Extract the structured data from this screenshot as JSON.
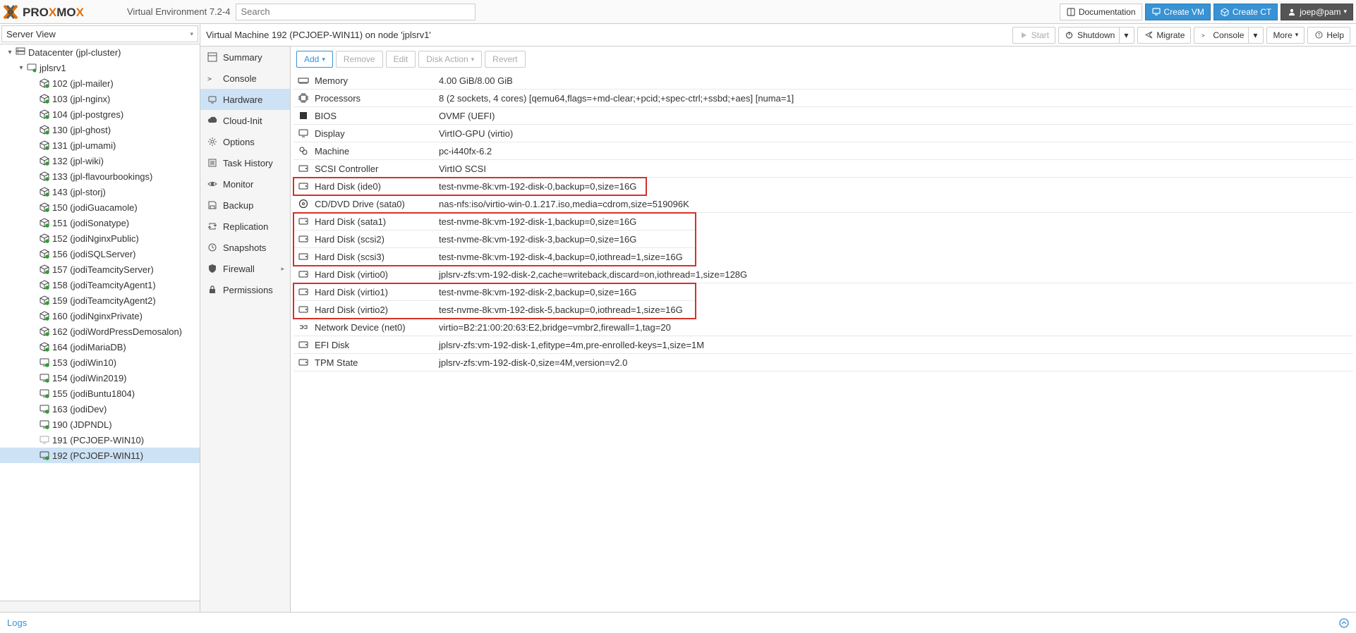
{
  "header": {
    "ve_label": "Virtual Environment 7.2-4",
    "search_placeholder": "Search",
    "documentation": "Documentation",
    "create_vm": "Create VM",
    "create_ct": "Create CT",
    "user": "joep@pam"
  },
  "view_selector": "Server View",
  "tree": {
    "datacenter": "Datacenter (jpl-cluster)",
    "node": "jplsrv1",
    "items": [
      {
        "id": "102",
        "label": "102 (jpl-mailer)",
        "type": "ct"
      },
      {
        "id": "103",
        "label": "103 (jpl-nginx)",
        "type": "ct"
      },
      {
        "id": "104",
        "label": "104 (jpl-postgres)",
        "type": "ct"
      },
      {
        "id": "130",
        "label": "130 (jpl-ghost)",
        "type": "ct"
      },
      {
        "id": "131",
        "label": "131 (jpl-umami)",
        "type": "ct"
      },
      {
        "id": "132",
        "label": "132 (jpl-wiki)",
        "type": "ct"
      },
      {
        "id": "133",
        "label": "133 (jpl-flavourbookings)",
        "type": "ct"
      },
      {
        "id": "143",
        "label": "143 (jpl-storj)",
        "type": "ct"
      },
      {
        "id": "150",
        "label": "150 (jodiGuacamole)",
        "type": "ct"
      },
      {
        "id": "151",
        "label": "151 (jodiSonatype)",
        "type": "ct"
      },
      {
        "id": "152",
        "label": "152 (jodiNginxPublic)",
        "type": "ct"
      },
      {
        "id": "156",
        "label": "156 (jodiSQLServer)",
        "type": "ct"
      },
      {
        "id": "157",
        "label": "157 (jodiTeamcityServer)",
        "type": "ct"
      },
      {
        "id": "158",
        "label": "158 (jodiTeamcityAgent1)",
        "type": "ct"
      },
      {
        "id": "159",
        "label": "159 (jodiTeamcityAgent2)",
        "type": "ct"
      },
      {
        "id": "160",
        "label": "160 (jodiNginxPrivate)",
        "type": "ct"
      },
      {
        "id": "162",
        "label": "162 (jodiWordPressDemosalon)",
        "type": "ct"
      },
      {
        "id": "164",
        "label": "164 (jodiMariaDB)",
        "type": "ct"
      },
      {
        "id": "153",
        "label": "153 (jodiWin10)",
        "type": "vm"
      },
      {
        "id": "154",
        "label": "154 (jodiWin2019)",
        "type": "vm"
      },
      {
        "id": "155",
        "label": "155 (jodiBuntu1804)",
        "type": "vm"
      },
      {
        "id": "163",
        "label": "163 (jodiDev)",
        "type": "vm"
      },
      {
        "id": "190",
        "label": "190 (JDPNDL)",
        "type": "vm"
      },
      {
        "id": "191",
        "label": "191 (PCJOEP-WIN10)",
        "type": "vm-off"
      },
      {
        "id": "192",
        "label": "192 (PCJOEP-WIN11)",
        "type": "vm",
        "selected": true
      }
    ]
  },
  "breadcrumb": {
    "title": "Virtual Machine 192 (PCJOEP-WIN11) on node 'jplsrv1'",
    "start": "Start",
    "shutdown": "Shutdown",
    "migrate": "Migrate",
    "console": "Console",
    "more": "More",
    "help": "Help"
  },
  "subnav": [
    {
      "icon": "summary",
      "label": "Summary"
    },
    {
      "icon": "console",
      "label": "Console"
    },
    {
      "icon": "hardware",
      "label": "Hardware",
      "active": true
    },
    {
      "icon": "cloud",
      "label": "Cloud-Init"
    },
    {
      "icon": "gear",
      "label": "Options"
    },
    {
      "icon": "task",
      "label": "Task History"
    },
    {
      "icon": "eye",
      "label": "Monitor"
    },
    {
      "icon": "save",
      "label": "Backup"
    },
    {
      "icon": "repl",
      "label": "Replication"
    },
    {
      "icon": "snap",
      "label": "Snapshots"
    },
    {
      "icon": "shield",
      "label": "Firewall",
      "expandable": true
    },
    {
      "icon": "lock",
      "label": "Permissions"
    }
  ],
  "toolbar": {
    "add": "Add",
    "remove": "Remove",
    "edit": "Edit",
    "disk_action": "Disk Action",
    "revert": "Revert"
  },
  "hardware": [
    {
      "icon": "memory",
      "name": "Memory",
      "value": "4.00 GiB/8.00 GiB"
    },
    {
      "icon": "cpu",
      "name": "Processors",
      "value": "8 (2 sockets, 4 cores) [qemu64,flags=+md-clear;+pcid;+spec-ctrl;+ssbd;+aes] [numa=1]"
    },
    {
      "icon": "bios",
      "name": "BIOS",
      "value": "OVMF (UEFI)"
    },
    {
      "icon": "display",
      "name": "Display",
      "value": "VirtIO-GPU (virtio)"
    },
    {
      "icon": "machine",
      "name": "Machine",
      "value": "pc-i440fx-6.2"
    },
    {
      "icon": "hdd",
      "name": "SCSI Controller",
      "value": "VirtIO SCSI"
    },
    {
      "icon": "hdd",
      "name": "Hard Disk (ide0)",
      "value": "test-nvme-8k:vm-192-disk-0,backup=0,size=16G",
      "hl": "single"
    },
    {
      "icon": "cd",
      "name": "CD/DVD Drive (sata0)",
      "value": "nas-nfs:iso/virtio-win-0.1.217.iso,media=cdrom,size=519096K"
    },
    {
      "icon": "hdd",
      "name": "Hard Disk (sata1)",
      "value": "test-nvme-8k:vm-192-disk-1,backup=0,size=16G",
      "hl": "g1-start"
    },
    {
      "icon": "hdd",
      "name": "Hard Disk (scsi2)",
      "value": "test-nvme-8k:vm-192-disk-3,backup=0,size=16G",
      "hl": "g1"
    },
    {
      "icon": "hdd",
      "name": "Hard Disk (scsi3)",
      "value": "test-nvme-8k:vm-192-disk-4,backup=0,iothread=1,size=16G",
      "hl": "g1-end"
    },
    {
      "icon": "hdd",
      "name": "Hard Disk (virtio0)",
      "value": "jplsrv-zfs:vm-192-disk-2,cache=writeback,discard=on,iothread=1,size=128G"
    },
    {
      "icon": "hdd",
      "name": "Hard Disk (virtio1)",
      "value": "test-nvme-8k:vm-192-disk-2,backup=0,size=16G",
      "hl": "g2-start"
    },
    {
      "icon": "hdd",
      "name": "Hard Disk (virtio2)",
      "value": "test-nvme-8k:vm-192-disk-5,backup=0,iothread=1,size=16G",
      "hl": "g2-end"
    },
    {
      "icon": "net",
      "name": "Network Device (net0)",
      "value": "virtio=B2:21:00:20:63:E2,bridge=vmbr2,firewall=1,tag=20"
    },
    {
      "icon": "hdd",
      "name": "EFI Disk",
      "value": "jplsrv-zfs:vm-192-disk-1,efitype=4m,pre-enrolled-keys=1,size=1M"
    },
    {
      "icon": "hdd",
      "name": "TPM State",
      "value": "jplsrv-zfs:vm-192-disk-0,size=4M,version=v2.0"
    }
  ],
  "logs_label": "Logs"
}
